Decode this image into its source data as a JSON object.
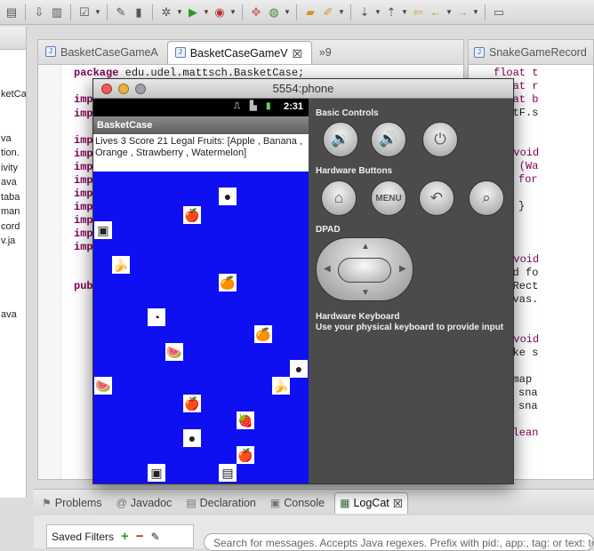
{
  "editor": {
    "tabs": [
      {
        "label": "BasketCaseGameA"
      },
      {
        "label": "BasketCaseGameV"
      }
    ],
    "overflow_label": "»9",
    "code_lines": [
      {
        "kw": "package",
        "text": " edu.udel.mattsch.BasketCase;"
      },
      {
        "kw": "impo",
        "text": ""
      },
      {
        "kw": "impo",
        "text": ""
      },
      {
        "kw": "impo",
        "text": ""
      },
      {
        "kw": "impo",
        "text": ""
      },
      {
        "kw": "impo",
        "text": ""
      },
      {
        "kw": "impo",
        "text": ""
      },
      {
        "kw": "impo",
        "text": ""
      },
      {
        "kw": "impo",
        "text": ""
      },
      {
        "kw": "impo",
        "text": ""
      },
      {
        "kw": "impo",
        "text": ""
      },
      {
        "kw": "impo",
        "text": ""
      },
      {
        "kw": "publ",
        "text": ""
      }
    ]
  },
  "left_panel": {
    "lines": [
      "ketCa",
      "",
      "",
      "va",
      "tion.",
      "ivity",
      "ava",
      "taba",
      "man",
      "cord",
      "v.ja",
      "",
      "",
      "",
      "",
      "ava"
    ]
  },
  "right_editor": {
    "tab_label": "SnakeGameRecord",
    "lines": [
      {
        "text": "float t"
      },
      {
        "text": "float r"
      },
      {
        "text": "float b"
      },
      {
        "text": "rectF.s"
      },
      {
        "text": "}"
      },
      {
        "text": ""
      },
      {
        "text": "public void"
      },
      {
        "text": "for (Wa"
      },
      {
        "text": "for"
      },
      {
        "text": ""
      },
      {
        "text": "}"
      },
      {
        "text": "}"
      },
      {
        "text": "}"
      },
      {
        "text": ""
      },
      {
        "text": "public void"
      },
      {
        "text": "Food fo"
      },
      {
        "text": "setRect"
      },
      {
        "text": "canvas."
      },
      {
        "text": "}"
      },
      {
        "text": ""
      },
      {
        "text": "public void"
      },
      {
        "text": "Snake s"
      },
      {
        "text": ""
      },
      {
        "text": "Bitmap"
      },
      {
        "text": "sna"
      },
      {
        "text": "sna"
      },
      {
        "text": ""
      },
      {
        "text": "boolean"
      }
    ]
  },
  "bottom": {
    "tabs": [
      {
        "label": "Problems"
      },
      {
        "label": "Javadoc"
      },
      {
        "label": "Declaration"
      },
      {
        "label": "Console"
      },
      {
        "label": "LogCat"
      }
    ],
    "saved_filters": "Saved Filters",
    "search_placeholder": "Search for messages. Accepts Java regexes. Prefix with pid:, app:, tag: or text: to"
  },
  "emulator": {
    "title": "5554:phone",
    "status": {
      "time": "2:31"
    },
    "app_title": "BasketCase",
    "info_text": "Lives 3  Score 21 Legal Fruits: [Apple , Banana , Orange , Strawberry , Watermelon]",
    "game_colors": {
      "background": "#0e10f2"
    },
    "fruits": [
      {
        "name": "bomb",
        "glyph": "●"
      },
      {
        "name": "apple",
        "glyph": "🍎"
      },
      {
        "name": "pineapple",
        "glyph": "▣"
      },
      {
        "name": "banana",
        "glyph": "🍌"
      },
      {
        "name": "orange",
        "glyph": "🍊"
      },
      {
        "name": "clock",
        "glyph": "◔"
      },
      {
        "name": "orange",
        "glyph": "🍊"
      },
      {
        "name": "watermelon",
        "glyph": "🍉"
      },
      {
        "name": "bomb",
        "glyph": "●"
      },
      {
        "name": "watermelon",
        "glyph": "🍉"
      },
      {
        "name": "banana",
        "glyph": "🍌"
      },
      {
        "name": "apple",
        "glyph": "🍎"
      },
      {
        "name": "strawberry",
        "glyph": "🍓"
      },
      {
        "name": "bomb",
        "glyph": "●"
      },
      {
        "name": "apple",
        "glyph": "🍎"
      },
      {
        "name": "pineapple",
        "glyph": "▣"
      },
      {
        "name": "basket",
        "glyph": "▤"
      }
    ],
    "controls": {
      "basic_label": "Basic Controls",
      "hardware_label": "Hardware Buttons",
      "menu_label": "MENU",
      "dpad_label": "DPAD",
      "keyboard_label": "Hardware Keyboard",
      "keyboard_hint": "Use your physical keyboard to provide input"
    }
  }
}
